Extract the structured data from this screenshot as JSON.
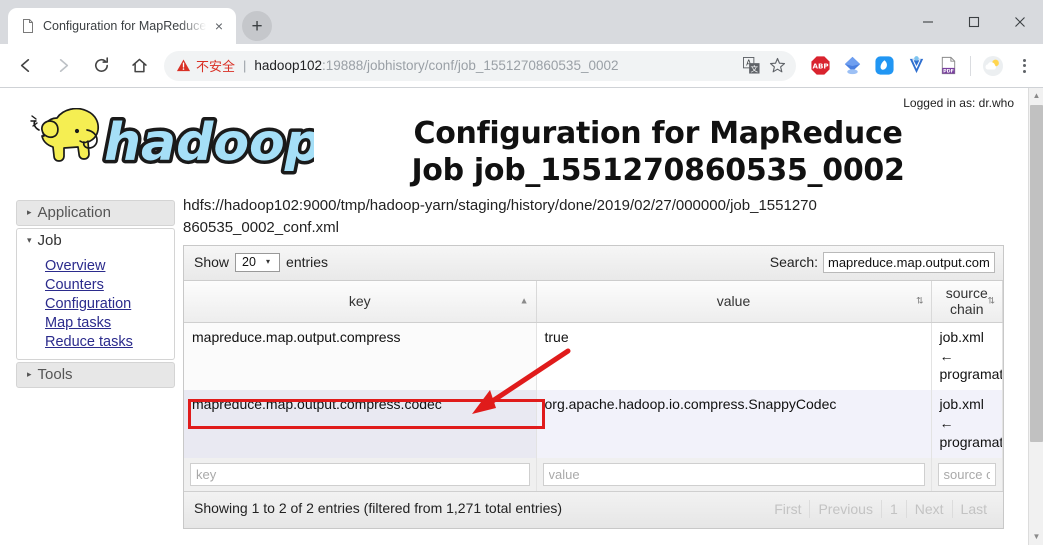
{
  "browser": {
    "tab": {
      "title": "Configuration for MapReduce",
      "favicon": "page-icon",
      "close": "×"
    },
    "newtab_label": "+",
    "window": {
      "minimize": "–",
      "maximize": "❐",
      "close": "✕"
    },
    "nav": {
      "back": "←",
      "forward": "→",
      "reload": "⟳",
      "home": "⌂"
    },
    "omnibox": {
      "security_label": "不安全",
      "separator": "|",
      "url_host": "hadoop102",
      "url_rest": ":19888/jobhistory/conf/job_1551270860535_0002",
      "icons": [
        "translate-icon",
        "bookmark-star-icon"
      ]
    },
    "extensions": [
      "adblock-plus-icon",
      "diamond-icon",
      "blue-circle-icon",
      "v-badge-icon",
      "pdf-icon",
      "weather-icon"
    ],
    "menu": "browser-menu-icon"
  },
  "page": {
    "logged_in_as": "Logged in as: dr.who",
    "logo_text": "hadoop",
    "title_line1": "Configuration for MapReduce",
    "title_line2": "Job job_1551270860535_0002",
    "conf_path": "hdfs://hadoop102:9000/tmp/hadoop-yarn/staging/history/done/2019/02/27/000000/job_1551270860535_0002_conf.xml"
  },
  "sidebar": {
    "blocks": [
      {
        "label": "Application",
        "caret": "▸",
        "expanded": false
      },
      {
        "label": "Job",
        "caret": "▾",
        "expanded": true,
        "items": [
          "Overview",
          "Counters",
          "Configuration",
          "Map tasks",
          "Reduce tasks"
        ]
      },
      {
        "label": "Tools",
        "caret": "▸",
        "expanded": false
      }
    ]
  },
  "table": {
    "show_label": "Show",
    "entries_label": "entries",
    "page_length": "20",
    "page_length_arrow": "▾",
    "search_label": "Search:",
    "search_value": "mapreduce.map.output.compress",
    "columns": [
      {
        "label": "key",
        "sort": "▲"
      },
      {
        "label": "value",
        "sort": "⇅"
      },
      {
        "label": "source chain",
        "sort": "⇅"
      }
    ],
    "rows": [
      {
        "key": "mapreduce.map.output.compress",
        "value": "true",
        "source": "job.xml ← programatically"
      },
      {
        "key": "mapreduce.map.output.compress.codec",
        "value": "org.apache.hadoop.io.compress.SnappyCodec",
        "source": "job.xml ← programatically"
      }
    ],
    "filters": [
      {
        "placeholder": "key",
        "value": ""
      },
      {
        "placeholder": "value",
        "value": ""
      },
      {
        "placeholder": "source chain",
        "value": ""
      }
    ],
    "showing_info": "Showing 1 to 2 of 2 entries (filtered from 1,271 total entries)",
    "pagination": [
      "First",
      "Previous",
      "1",
      "Next",
      "Last"
    ]
  },
  "annotation": {
    "color": "#e01b1b",
    "shape": "arrow-and-box"
  },
  "scrollbar": {
    "up": "▲",
    "down": "▼"
  }
}
